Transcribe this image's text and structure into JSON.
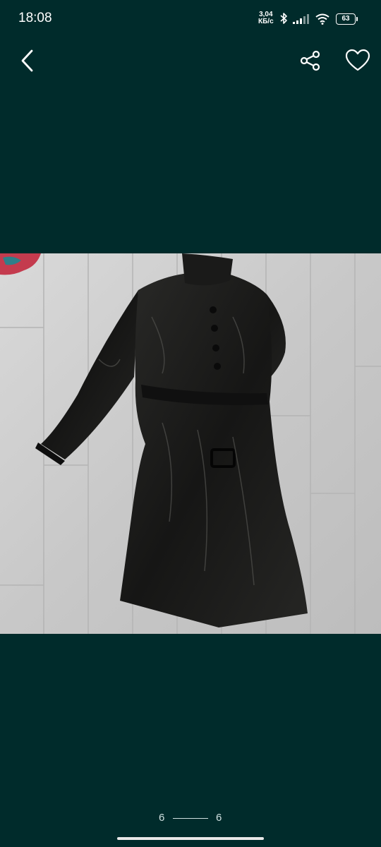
{
  "status_bar": {
    "time": "18:08",
    "net_speed_value": "3,04",
    "net_speed_unit": "КБ/с",
    "battery": "63"
  },
  "toolbar": {
    "back_icon": "chevron-left-icon",
    "share_icon": "share-icon",
    "favorite_icon": "heart-icon"
  },
  "gallery": {
    "current_page": "6",
    "total_pages": "6"
  },
  "colors": {
    "background": "#002b2b",
    "foreground": "#ffffff"
  }
}
